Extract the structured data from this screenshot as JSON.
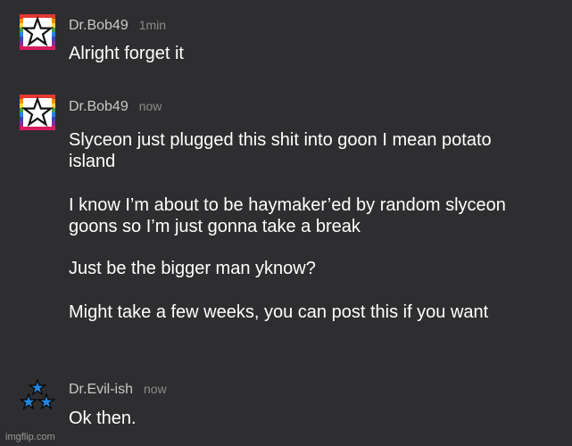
{
  "messages": [
    {
      "author": "Dr.Bob49",
      "time": "1min",
      "avatar_icon": "rainbow-star-icon",
      "lines": [
        "Alright forget it"
      ]
    },
    {
      "author": "Dr.Bob49",
      "time": "now",
      "avatar_icon": "rainbow-star-icon",
      "lines": [
        "Slyceon just plugged this shit into goon I mean potato island",
        "I know I’m about to be haymaker’ed by random slyceon goons so I’m just gonna take a break",
        "Just be the bigger man yknow?",
        "Might take a few weeks, you can post this if you want"
      ]
    },
    {
      "author": "Dr.Evil-ish",
      "time": "now",
      "avatar_icon": "blue-stars-icon",
      "lines": [
        "Ok then."
      ]
    }
  ],
  "watermark": "imgflip.com",
  "colors": {
    "background": "#2e2e30",
    "author": "#c8c8c8",
    "timestamp": "#8a8a8a",
    "text": "#ffffff"
  }
}
